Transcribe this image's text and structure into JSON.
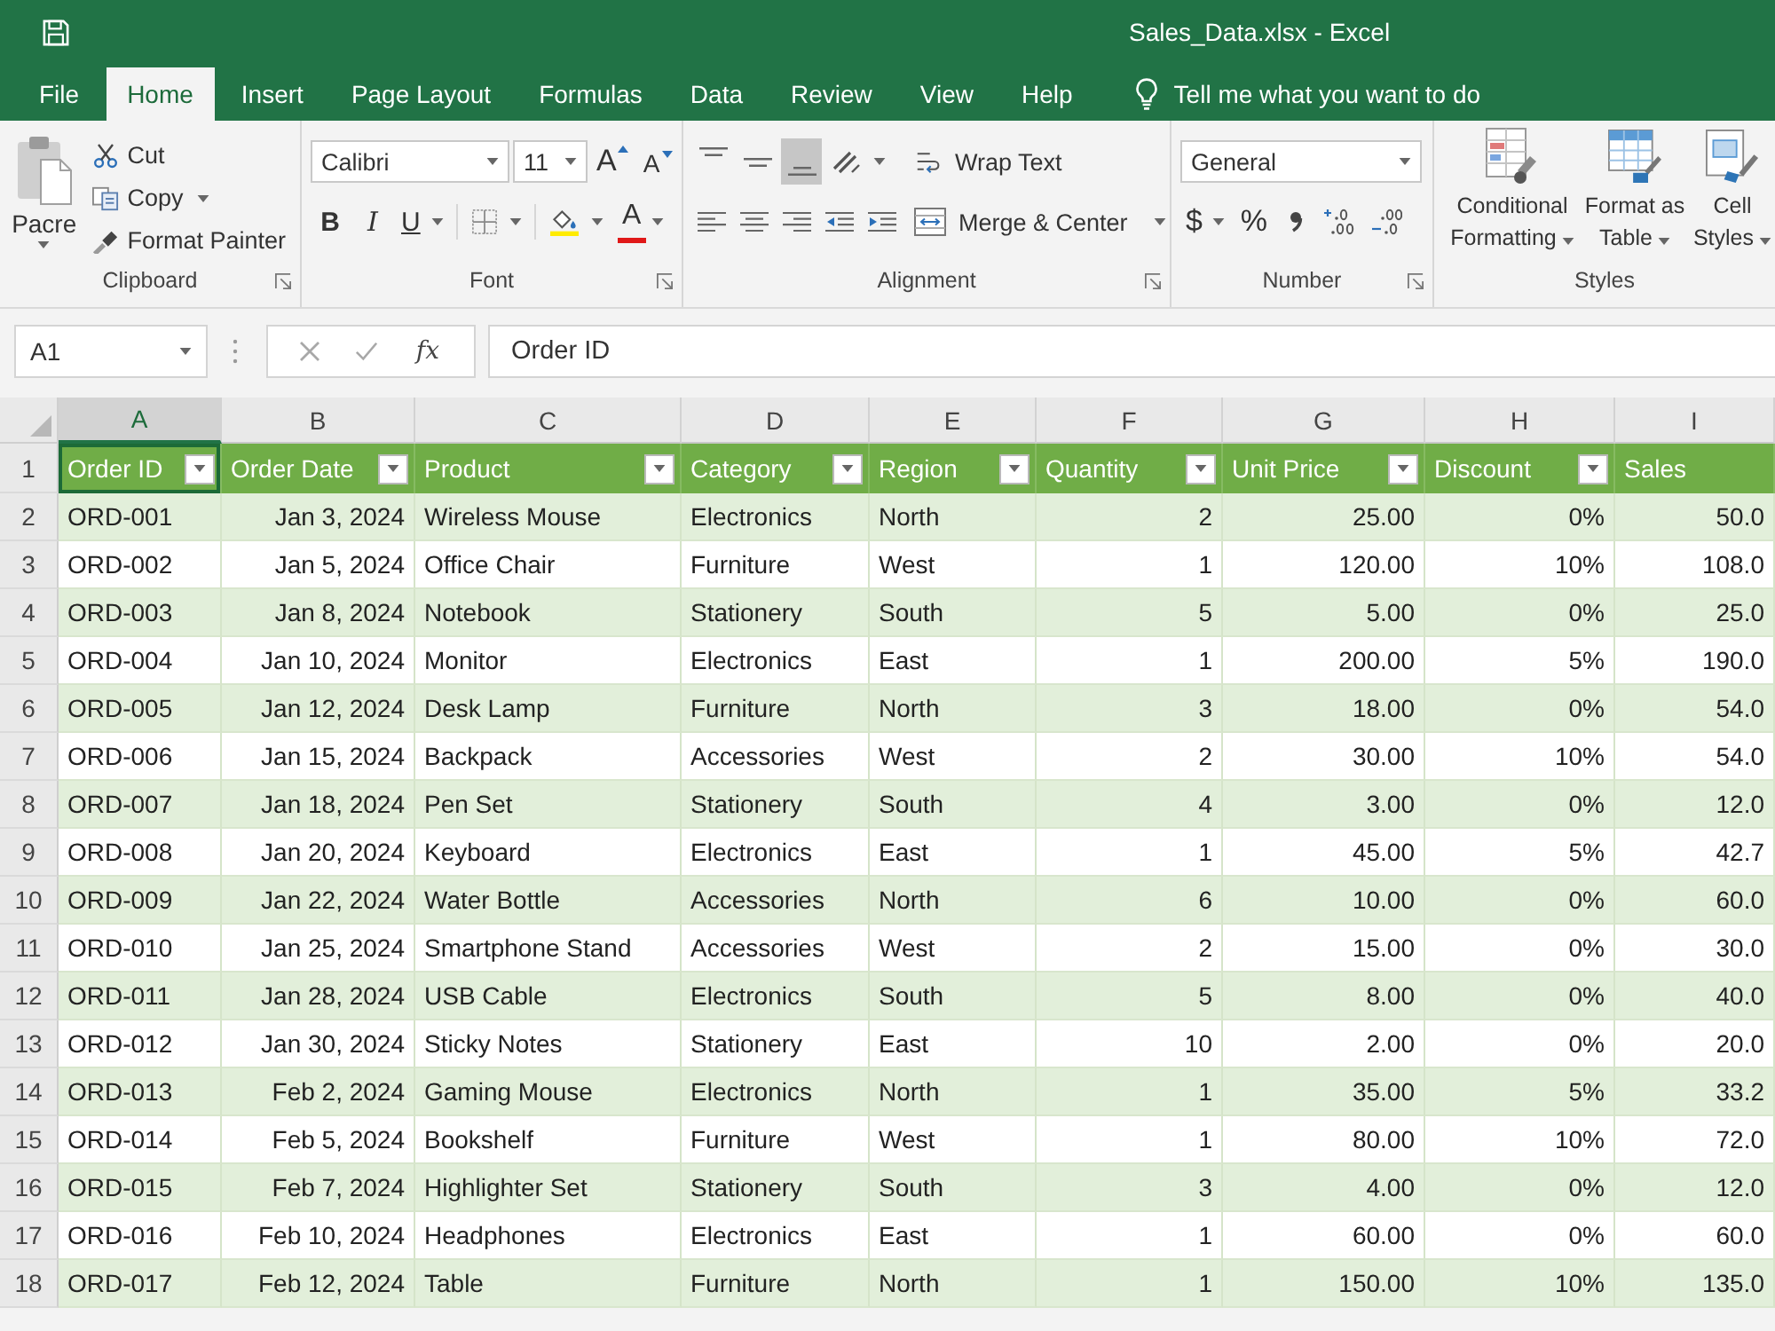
{
  "window": {
    "title": "Sales_Data.xlsx - Excel"
  },
  "ribbon_tabs": [
    {
      "label": "File",
      "selected": false
    },
    {
      "label": "Home",
      "selected": true
    },
    {
      "label": "Insert",
      "selected": false
    },
    {
      "label": "Page Layout",
      "selected": false
    },
    {
      "label": "Formulas",
      "selected": false
    },
    {
      "label": "Data",
      "selected": false
    },
    {
      "label": "Review",
      "selected": false
    },
    {
      "label": "View",
      "selected": false
    },
    {
      "label": "Help",
      "selected": false
    }
  ],
  "tell_me": {
    "placeholder": "Tell me what you want to do"
  },
  "ribbon": {
    "clipboard": {
      "label": "Clipboard",
      "paste": "Pacre",
      "cut": "Cut",
      "copy": "Copy",
      "format_painter": "Format Painter"
    },
    "font": {
      "label": "Font",
      "font_name": "Calibri",
      "font_size": "11",
      "grow": "A",
      "shrink": "A",
      "bold": "B",
      "italic": "I",
      "underline": "U",
      "font_color": "A"
    },
    "alignment": {
      "label": "Alignment",
      "vertical_align": [
        {
          "kind": "top",
          "selected": false
        },
        {
          "kind": "middle",
          "selected": false
        },
        {
          "kind": "bottom",
          "selected": true
        }
      ],
      "wrap_text": "Wrap Text",
      "merge_center": "Merge & Center"
    },
    "number": {
      "label": "Number",
      "format": "General",
      "currency": "$",
      "percent": "%"
    },
    "styles": {
      "label": "Styles",
      "items": [
        {
          "kind": "conditional",
          "label": "Conditional Formatting"
        },
        {
          "kind": "table",
          "label": "Format as Table"
        },
        {
          "kind": "cell",
          "label": "Cell Styles"
        }
      ]
    }
  },
  "formula_bar": {
    "name_box": "A1",
    "function_label": "fx",
    "value": "Order ID"
  },
  "sheet": {
    "column_letters": [
      {
        "label": "A",
        "selected": true
      },
      {
        "label": "B",
        "selected": false
      },
      {
        "label": "C",
        "selected": false
      },
      {
        "label": "D",
        "selected": false
      },
      {
        "label": "E",
        "selected": false
      },
      {
        "label": "F",
        "selected": false
      },
      {
        "label": "G",
        "selected": false
      },
      {
        "label": "H",
        "selected": false
      },
      {
        "label": "I",
        "selected": false
      }
    ],
    "row_numbers": [
      "1",
      "2",
      "3",
      "4",
      "5",
      "6",
      "7",
      "8",
      "9",
      "10",
      "11",
      "12",
      "13",
      "14",
      "15",
      "16",
      "17",
      "18"
    ],
    "columns": [
      {
        "header": "Order ID",
        "kind": "text",
        "filter": true,
        "selected": true
      },
      {
        "header": "Order Date",
        "kind": "number",
        "filter": true,
        "selected": false
      },
      {
        "header": "Product",
        "kind": "text",
        "filter": true,
        "selected": false
      },
      {
        "header": "Category",
        "kind": "text",
        "filter": true,
        "selected": false
      },
      {
        "header": "Region",
        "kind": "text",
        "filter": true,
        "selected": false
      },
      {
        "header": "Quantity",
        "kind": "number",
        "filter": true,
        "selected": false
      },
      {
        "header": "Unit Price",
        "kind": "number",
        "filter": true,
        "selected": false
      },
      {
        "header": "Discount",
        "kind": "number",
        "filter": true,
        "selected": false
      },
      {
        "header": "Sales",
        "kind": "number",
        "filter": false,
        "selected": false
      }
    ],
    "rows": [
      [
        "ORD-001",
        "Jan 3, 2024",
        "Wireless Mouse",
        "Electronics",
        "North",
        "2",
        "25.00",
        "0%",
        "50.0"
      ],
      [
        "ORD-002",
        "Jan 5, 2024",
        "Office Chair",
        "Furniture",
        "West",
        "1",
        "120.00",
        "10%",
        "108.0"
      ],
      [
        "ORD-003",
        "Jan 8, 2024",
        "Notebook",
        "Stationery",
        "South",
        "5",
        "5.00",
        "0%",
        "25.0"
      ],
      [
        "ORD-004",
        "Jan 10, 2024",
        "Monitor",
        "Electronics",
        "East",
        "1",
        "200.00",
        "5%",
        "190.0"
      ],
      [
        "ORD-005",
        "Jan 12, 2024",
        "Desk Lamp",
        "Furniture",
        "North",
        "3",
        "18.00",
        "0%",
        "54.0"
      ],
      [
        "ORD-006",
        "Jan 15, 2024",
        "Backpack",
        "Accessories",
        "West",
        "2",
        "30.00",
        "10%",
        "54.0"
      ],
      [
        "ORD-007",
        "Jan 18, 2024",
        "Pen Set",
        "Stationery",
        "South",
        "4",
        "3.00",
        "0%",
        "12.0"
      ],
      [
        "ORD-008",
        "Jan 20, 2024",
        "Keyboard",
        "Electronics",
        "East",
        "1",
        "45.00",
        "5%",
        "42.7"
      ],
      [
        "ORD-009",
        "Jan 22, 2024",
        "Water Bottle",
        "Accessories",
        "North",
        "6",
        "10.00",
        "0%",
        "60.0"
      ],
      [
        "ORD-010",
        "Jan 25, 2024",
        "Smartphone Stand",
        "Accessories",
        "West",
        "2",
        "15.00",
        "0%",
        "30.0"
      ],
      [
        "ORD-011",
        "Jan 28, 2024",
        "USB Cable",
        "Electronics",
        "South",
        "5",
        "8.00",
        "0%",
        "40.0"
      ],
      [
        "ORD-012",
        "Jan 30, 2024",
        "Sticky Notes",
        "Stationery",
        "East",
        "10",
        "2.00",
        "0%",
        "20.0"
      ],
      [
        "ORD-013",
        "Feb 2, 2024",
        "Gaming Mouse",
        "Electronics",
        "North",
        "1",
        "35.00",
        "5%",
        "33.2"
      ],
      [
        "ORD-014",
        "Feb 5, 2024",
        "Bookshelf",
        "Furniture",
        "West",
        "1",
        "80.00",
        "10%",
        "72.0"
      ],
      [
        "ORD-015",
        "Feb 7, 2024",
        "Highlighter Set",
        "Stationery",
        "South",
        "3",
        "4.00",
        "0%",
        "12.0"
      ],
      [
        "ORD-016",
        "Feb 10, 2024",
        "Headphones",
        "Electronics",
        "East",
        "1",
        "60.00",
        "0%",
        "60.0"
      ],
      [
        "ORD-017",
        "Feb 12, 2024",
        "Table",
        "Furniture",
        "North",
        "1",
        "150.00",
        "10%",
        "135.0"
      ]
    ]
  }
}
